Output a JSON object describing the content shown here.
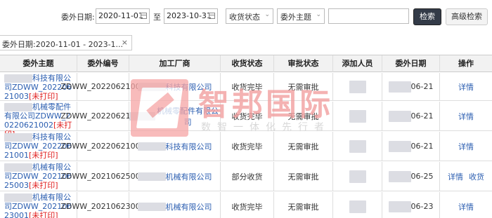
{
  "filters": {
    "date_label": "委外日期:",
    "date_start": "2020-11-01",
    "date_sep": "至",
    "date_end": "2023-10-31",
    "receive_status": "收货状态",
    "theme_select": "委外主题",
    "search_value": "",
    "search_button": "检索",
    "advanced_button": "高级检索"
  },
  "tag": {
    "label": "委外日期:2020-11-01 - 2023-1...",
    "close": "×"
  },
  "table": {
    "headers": [
      "委外主题",
      "委外编号",
      "加工厂商",
      "收货状态",
      "审批状态",
      "添加人员",
      "委外日期",
      "操作"
    ],
    "rows": [
      {
        "theme": "科技有限公司ZDWW_20220621003",
        "unprinted": "[未打印]",
        "code": "ZDWW_20220621003",
        "factory": "科技有限公司",
        "receive": "收货完毕",
        "approve": "无需审批",
        "date": "06-21",
        "actions": [
          "详情"
        ]
      },
      {
        "theme": "机械零配件有限公司ZDWW_20220621002",
        "unprinted": "[未打印]",
        "code": "ZDWW_20220621002",
        "factory": "机械零配件有限公司",
        "receive": "收货完毕",
        "approve": "无需审批",
        "date": "06-21",
        "actions": [
          "详情"
        ]
      },
      {
        "theme": "科技有限公司ZDWW_20220621001",
        "unprinted": "[未打印]",
        "code": "ZDWW_20220621001",
        "factory": "科技有限公司",
        "receive": "收货完毕",
        "approve": "无需审批",
        "date": "06-21",
        "actions": [
          "详情"
        ]
      },
      {
        "theme": "机械有限公司ZDWW_20210625003",
        "unprinted": "[未打印]",
        "code": "ZDWW_20210625003",
        "factory": "机械有限公司",
        "receive": "部分收货",
        "approve": "无需审批",
        "date": "06-25",
        "actions": [
          "详情",
          "收货"
        ]
      },
      {
        "theme": "机械有限公司ZDWW_20210623001",
        "unprinted": "[未打印]",
        "code": "ZDWW_20210623001",
        "factory": "机械有限公司",
        "receive": "收货完毕",
        "approve": "无需审批",
        "date": "06-23",
        "actions": [
          "详情"
        ]
      }
    ]
  },
  "watermark": {
    "title": "智邦国际",
    "subtitle": "数智一体化先行者"
  },
  "colors": {
    "link": "#2a5db0",
    "unprinted": "#e02020",
    "watermark": "#f2a0a0",
    "header_bg": "#f2f2f2",
    "primary_button": "#333b48"
  }
}
